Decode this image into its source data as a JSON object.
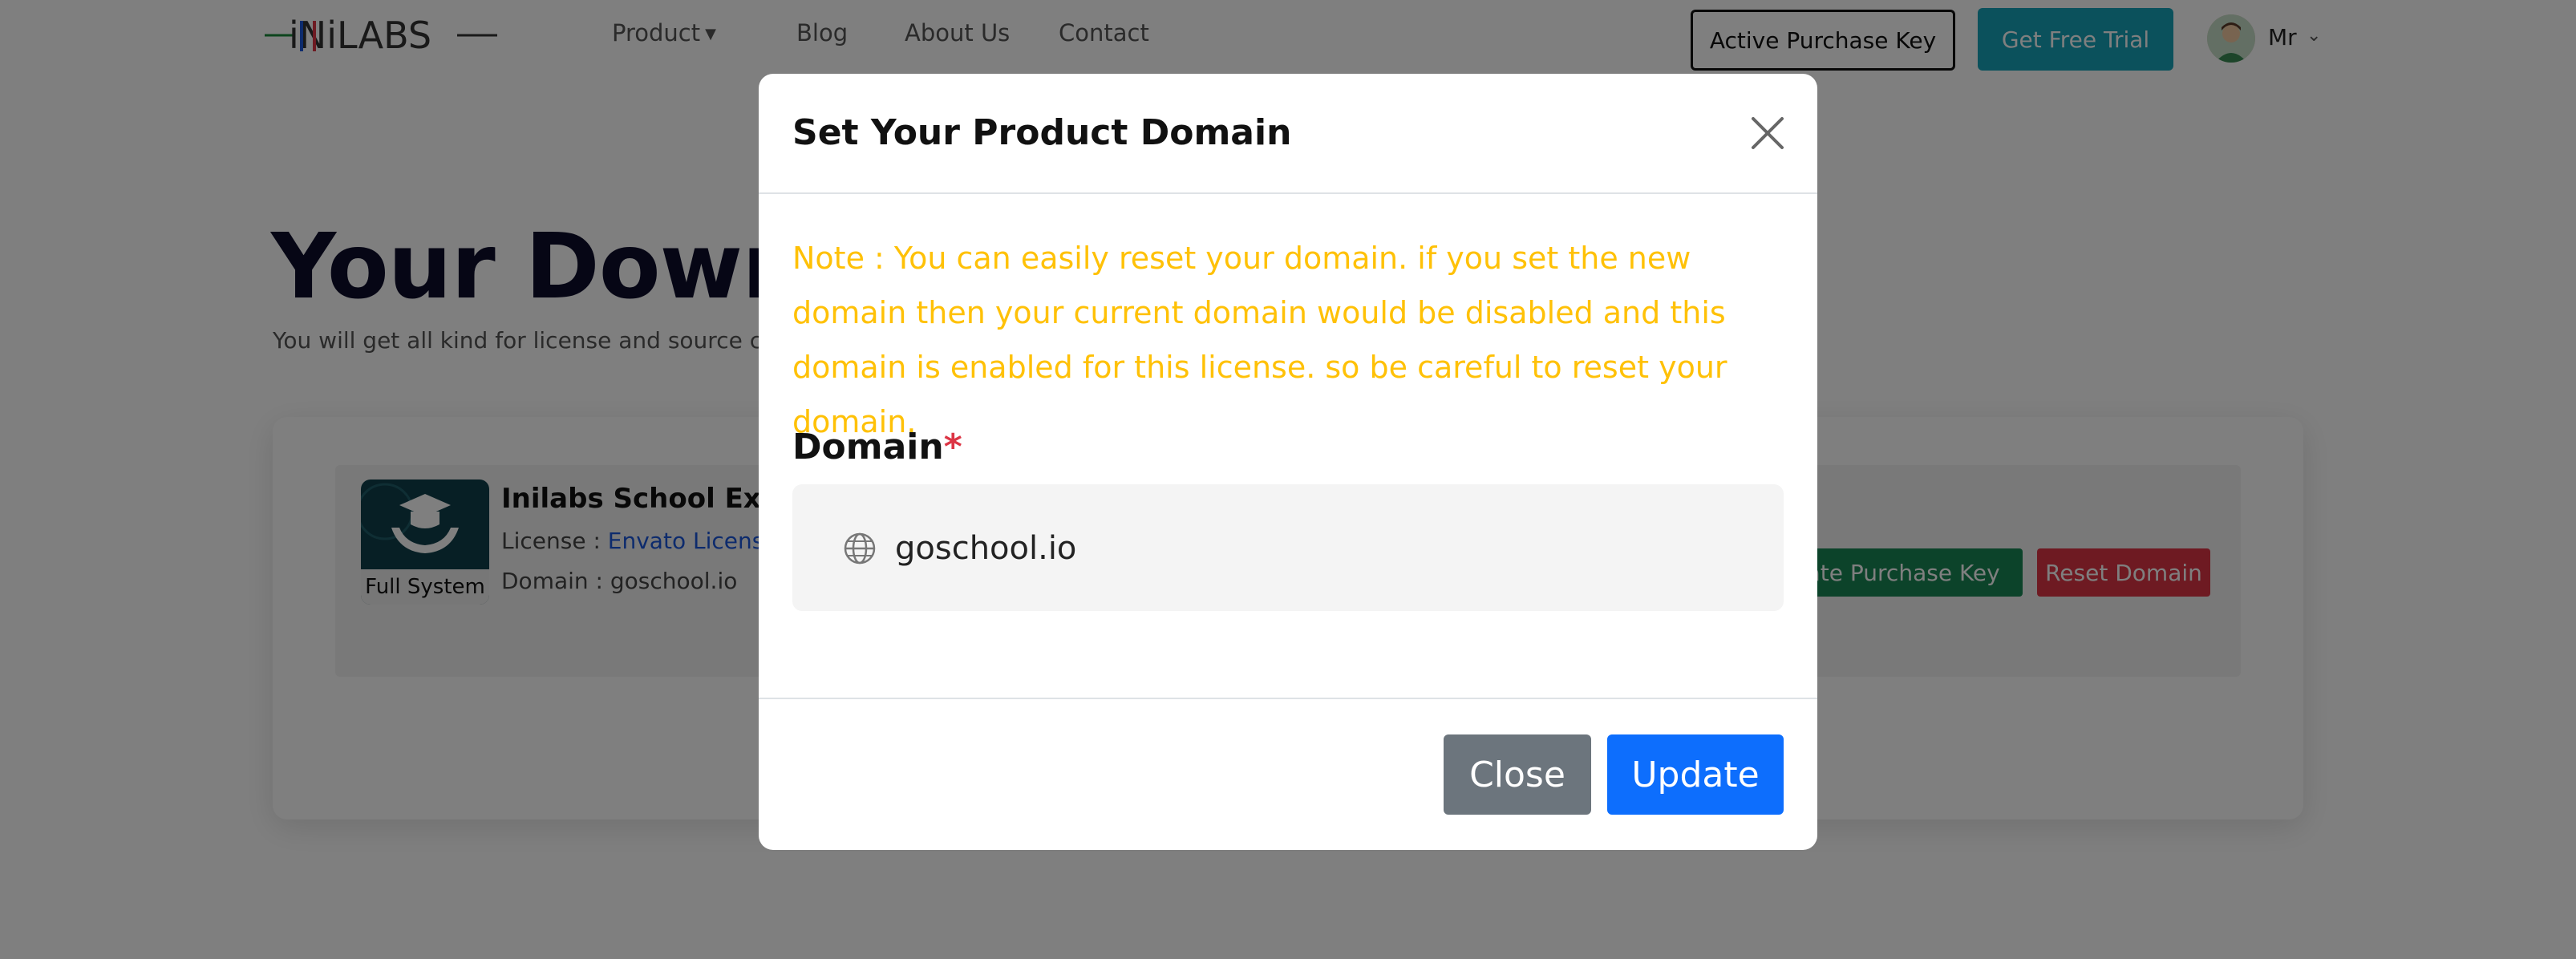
{
  "header": {
    "logo_text": "iNiLABS",
    "nav": {
      "product": "Product",
      "blog": "Blog",
      "about": "About Us",
      "contact": "Contact"
    },
    "active_purchase_key": "Active Purchase Key",
    "free_trial": "Get Free Trial",
    "user_name": "Mr"
  },
  "page": {
    "title": "Your Downlo",
    "subtitle": "You will get all kind for license and source code"
  },
  "license_item": {
    "thumb_label": "Full System",
    "name": "Inilabs School Expres",
    "license_prefix": "License : ",
    "license_link": "Envato License",
    "domain_line": "Domain : goschool.io",
    "active_key_button": "ivate Purchase Key",
    "reset_button": "Reset Domain"
  },
  "modal": {
    "title": "Set Your Product Domain",
    "note": "Note : You can easily reset your domain. if you set the new domain then your current domain would be disabled and this domain is enabled for this license. so be careful to reset your domain.",
    "domain_label": "Domain",
    "required_mark": "*",
    "domain_value": "goschool.io",
    "close_button": "Close",
    "update_button": "Update"
  },
  "colors": {
    "warning": "#ffc107",
    "primary": "#0d6efd",
    "secondary": "#6c757d",
    "success": "#198754",
    "danger": "#dc3545",
    "info": "#17a2b8"
  }
}
